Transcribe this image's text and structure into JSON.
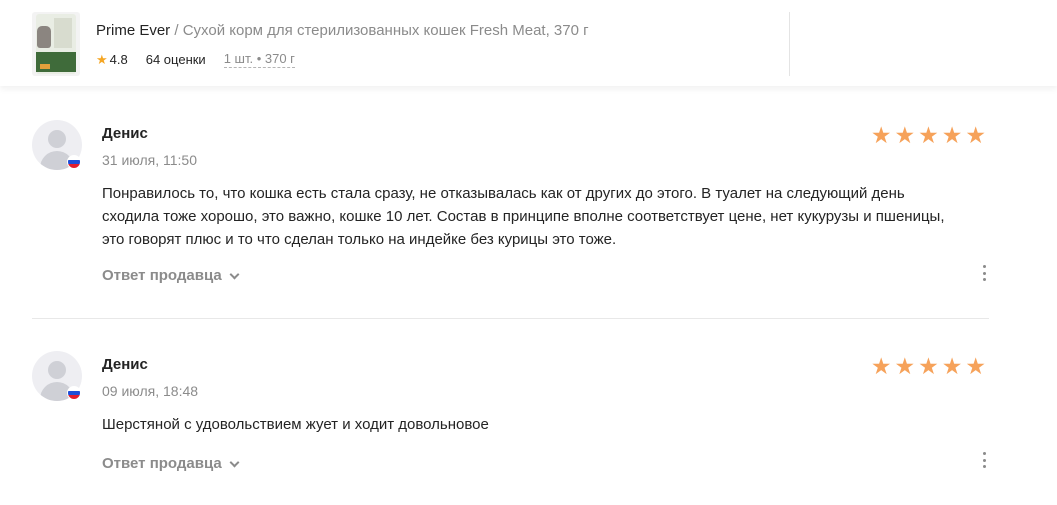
{
  "product": {
    "brand": "Prime Ever",
    "separator": "/",
    "name": "Сухой корм для стерилизованных кошек Fresh Meat, 370 г",
    "rating": "4.8",
    "reviews_count": "64 оценки",
    "pack": "1 шт. • 370 г",
    "icons": {
      "rating": "star-icon"
    },
    "colors": {
      "star": "#f6a25a",
      "muted": "#8b8b8b"
    }
  },
  "reviews": [
    {
      "author": "Денис",
      "date": "31 июля, 11:50",
      "stars": 5,
      "text": "Понравилось то, что кошка есть стала сразу, не отказывалась как от других до этого. В туалет на следующий день сходила тоже хорошо, это важно, кошке 10 лет. Состав в принципе вполне соответствует цене, нет кукурузы и пшеницы, это говорят плюс и то что сделан только на индейке без курицы это тоже.",
      "seller_reply": "Ответ продавца",
      "flag": "russia-flag-icon"
    },
    {
      "author": "Денис",
      "date": "09 июля, 18:48",
      "stars": 5,
      "text": "Шерстяной с удовольствием жует и ходит довольновое",
      "seller_reply": "Ответ продавца",
      "flag": "russia-flag-icon"
    }
  ]
}
